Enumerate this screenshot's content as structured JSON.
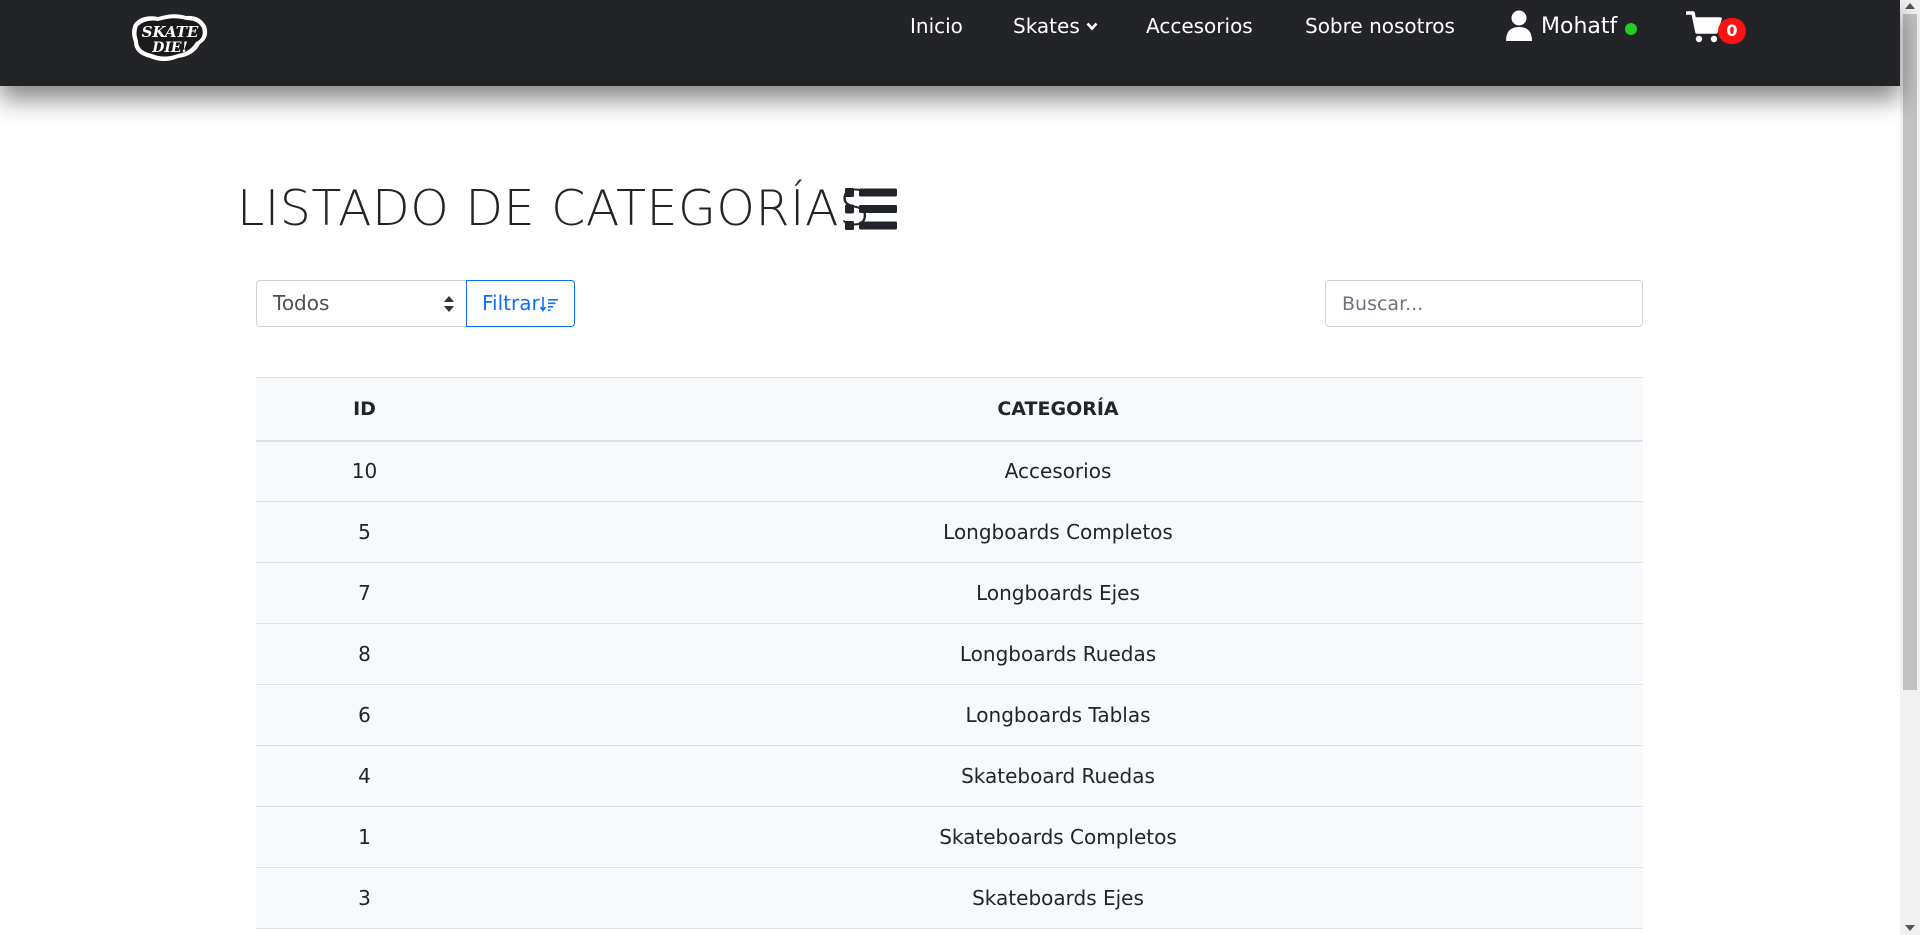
{
  "navbar": {
    "logo_text": "Skate or Die!",
    "links": {
      "inicio": "Inicio",
      "skates": "Skates",
      "accesorios": "Accesorios",
      "sobre": "Sobre nosotros"
    },
    "user_name": "Mohatf",
    "online_color": "#22cc22",
    "cart_count": "0",
    "icons": [
      "chevron-down-icon",
      "user-icon",
      "cart-icon"
    ]
  },
  "page": {
    "title": "LISTADO DE CATEGORÍAS",
    "title_icon": "list-icon"
  },
  "filters": {
    "select_value": "Todos",
    "filter_button": "Filtrar",
    "filter_icon": "sort-amount-down-icon",
    "search_placeholder": "Buscar..."
  },
  "table": {
    "headers": [
      "ID",
      "CATEGORÍA"
    ],
    "rows": [
      {
        "id": "10",
        "categoria": "Accesorios"
      },
      {
        "id": "5",
        "categoria": "Longboards Completos"
      },
      {
        "id": "7",
        "categoria": "Longboards Ejes"
      },
      {
        "id": "8",
        "categoria": "Longboards Ruedas"
      },
      {
        "id": "6",
        "categoria": "Longboards Tablas"
      },
      {
        "id": "4",
        "categoria": "Skateboard Ruedas"
      },
      {
        "id": "1",
        "categoria": "Skateboards Completos"
      },
      {
        "id": "3",
        "categoria": "Skateboards Ejes"
      }
    ]
  },
  "colors": {
    "navbar_bg": "#232427",
    "primary": "#0d6efd",
    "badge": "#ff1111",
    "table_bg": "#f8f9fa"
  }
}
